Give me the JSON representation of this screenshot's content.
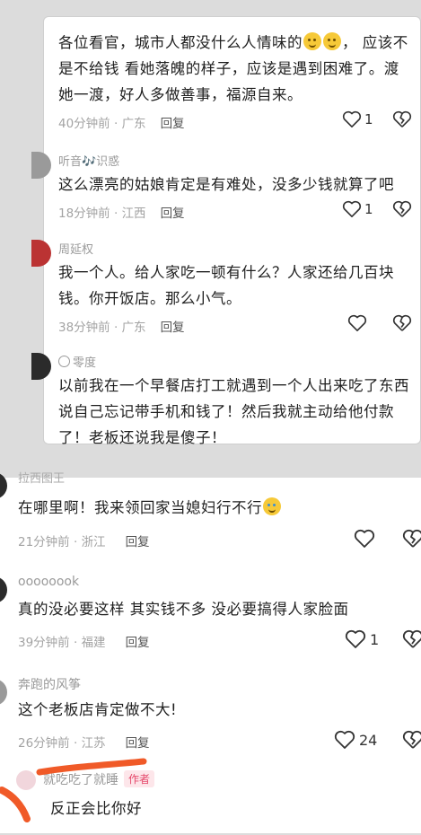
{
  "top": {
    "comments": [
      {
        "username": "",
        "text": "各位看官，城市人都没什么人情味的",
        "text_after": "，  应该不是不给钱 看她落魄的样子，应该是遇到困难了。渡她一渡，好人多做善事，福源自来。",
        "time": "40分钟前",
        "location": "广东",
        "reply": "回复",
        "likes": "1"
      },
      {
        "username": "听音🎶识惑",
        "text": "这么漂亮的姑娘肯定是有难处，没多少钱就算了吧",
        "time": "18分钟前",
        "location": "江西",
        "reply": "回复",
        "likes": "1"
      },
      {
        "username": "周延权",
        "text": "我一个人。给人家吃一顿有什么？人家还给几百块钱。你开饭店。那么小气。",
        "time": "38分钟前",
        "location": "广东",
        "reply": "回复",
        "likes": ""
      },
      {
        "username": "零度",
        "text": "以前我在一个早餐店打工就遇到一个人出来吃了东西说自己忘记带手机和钱了！然后我就主动给他付款了！老板还说我是傻子！"
      }
    ]
  },
  "bottom": {
    "comments": [
      {
        "username": "拉西图王",
        "text": "在哪里啊！我来领回家当媳妇行不行",
        "time": "21分钟前",
        "location": "浙江",
        "reply": "回复",
        "likes": ""
      },
      {
        "username": "oooooook",
        "text": "真的没必要这样 其实钱不多 没必要搞得人家脸面",
        "time": "39分钟前",
        "location": "福建",
        "reply": "回复",
        "likes": "1"
      },
      {
        "username": "奔跑的风筝",
        "text": "这个老板店肯定做不大!",
        "time": "26分钟前",
        "location": "江苏",
        "reply": "回复",
        "likes": "24"
      },
      {
        "username": "就吃吃了就睡",
        "badge": "作者",
        "text": "反正会比你好"
      }
    ]
  },
  "colors": {
    "accent": "#e5486b",
    "scribble": "#f05a28"
  },
  "icons": {
    "like": "heart-icon",
    "dislike": "broken-heart-icon"
  }
}
